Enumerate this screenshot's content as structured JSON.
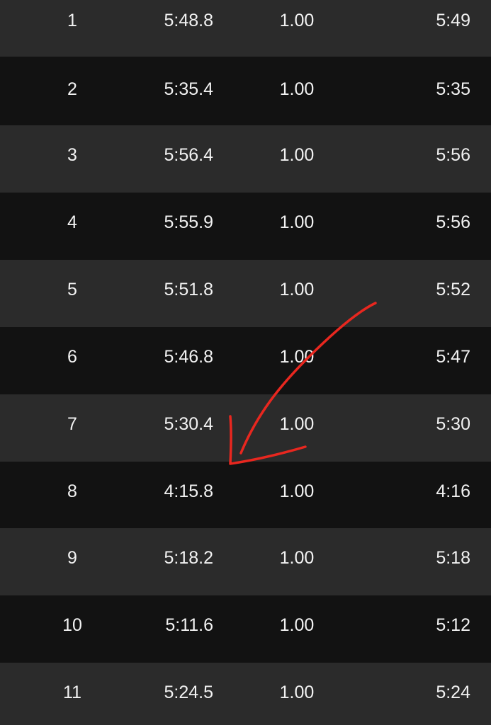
{
  "splits_table": {
    "rows": [
      {
        "split": "1",
        "time": "5:48.8",
        "distance": "1.00",
        "pace": "5:49"
      },
      {
        "split": "2",
        "time": "5:35.4",
        "distance": "1.00",
        "pace": "5:35"
      },
      {
        "split": "3",
        "time": "5:56.4",
        "distance": "1.00",
        "pace": "5:56"
      },
      {
        "split": "4",
        "time": "5:55.9",
        "distance": "1.00",
        "pace": "5:56"
      },
      {
        "split": "5",
        "time": "5:51.8",
        "distance": "1.00",
        "pace": "5:52"
      },
      {
        "split": "6",
        "time": "5:46.8",
        "distance": "1.00",
        "pace": "5:47"
      },
      {
        "split": "7",
        "time": "5:30.4",
        "distance": "1.00",
        "pace": "5:30"
      },
      {
        "split": "8",
        "time": "4:15.8",
        "distance": "1.00",
        "pace": "4:16"
      },
      {
        "split": "9",
        "time": "5:18.2",
        "distance": "1.00",
        "pace": "5:18"
      },
      {
        "split": "10",
        "time": "5:11.6",
        "distance": "1.00",
        "pace": "5:12"
      },
      {
        "split": "11",
        "time": "5:24.5",
        "distance": "1.00",
        "pace": "5:24"
      }
    ]
  },
  "annotation": {
    "color": "#e8271f",
    "points_to_split": "8"
  }
}
